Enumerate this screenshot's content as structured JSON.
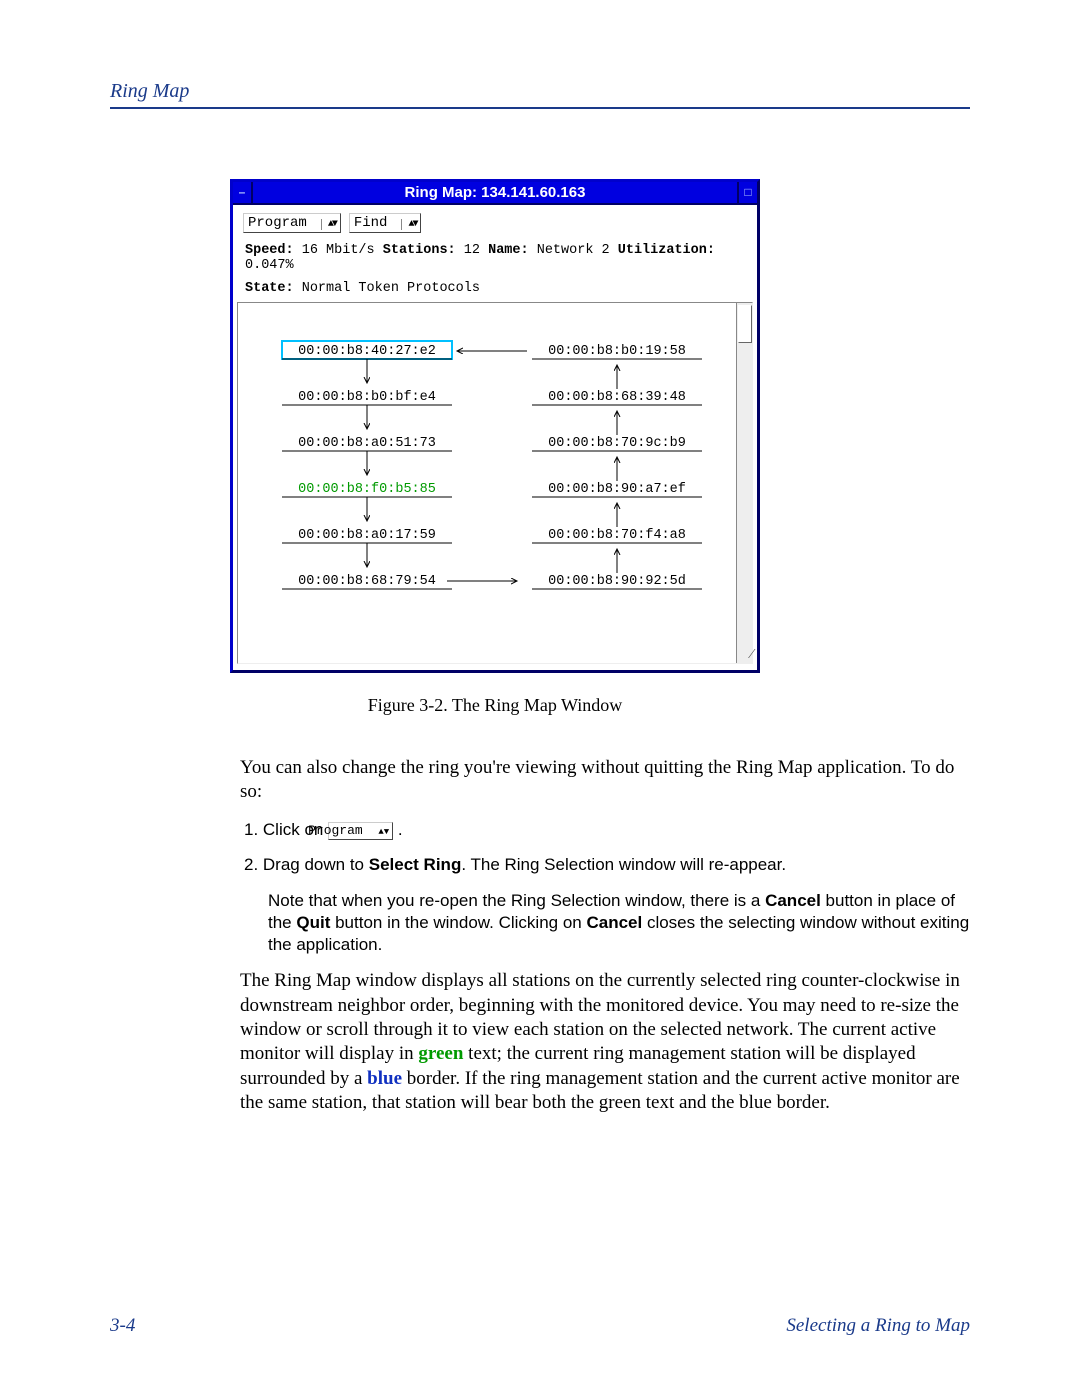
{
  "header": {
    "section": "Ring Map"
  },
  "window": {
    "title": "Ring Map: 134.141.60.163",
    "menus": {
      "program": "Program",
      "find": "Find"
    },
    "info": {
      "speed_label": "Speed:",
      "speed_value": "16 Mbit/s",
      "stations_label": "Stations:",
      "stations_value": "12",
      "name_label": "Name:",
      "name_value": "Network 2",
      "util_label": "Utilization:",
      "util_value": "0.047%"
    },
    "state": {
      "label": "State:",
      "value": "Normal Token Protocols"
    },
    "left_stations": [
      "00:00:b8:40:27:e2",
      "00:00:b8:b0:bf:e4",
      "00:00:b8:a0:51:73",
      "00:00:b8:f0:b5:85",
      "00:00:b8:a0:17:59",
      "00:00:b8:68:79:54"
    ],
    "right_stations": [
      "00:00:b8:b0:19:58",
      "00:00:b8:68:39:48",
      "00:00:b8:70:9c:b9",
      "00:00:b8:90:a7:ef",
      "00:00:b8:70:f4:a8",
      "00:00:b8:90:92:5d"
    ]
  },
  "caption": "Figure 3-2.  The Ring Map Window",
  "para1": "You can also change the ring you're viewing without quitting the Ring Map application. To do so:",
  "steps": {
    "s1_pre": "1.   Click on ",
    "s1_post": " .",
    "s2a": "2.   Drag down to ",
    "s2b": "Select Ring",
    "s2c": ". The Ring Selection window will re-appear.",
    "note_a": "Note that when you re-open the Ring Selection window, there is a ",
    "note_b": "Cancel",
    "note_c": " button in place of the ",
    "note_d": "Quit",
    "note_e": " button in the window. Clicking on ",
    "note_f": "Cancel",
    "note_g": " closes the selecting window without exiting the application."
  },
  "para2_a": "The Ring Map window displays all stations on the currently selected ring counter-clockwise in downstream neighbor order, beginning with the monitored device. You may need to re-size the window or scroll through it to view each station on the selected network. The current active monitor will display in ",
  "para2_green": "green",
  "para2_b": " text; the current ring management station will be displayed surrounded by a ",
  "para2_blue": "blue",
  "para2_c": " border. If the ring management station and the current active monitor are the same station, that station will bear both the green text and the blue border.",
  "footer": {
    "pagenum": "3-4",
    "section": "Selecting a Ring to Map"
  },
  "inline_program": "Program"
}
